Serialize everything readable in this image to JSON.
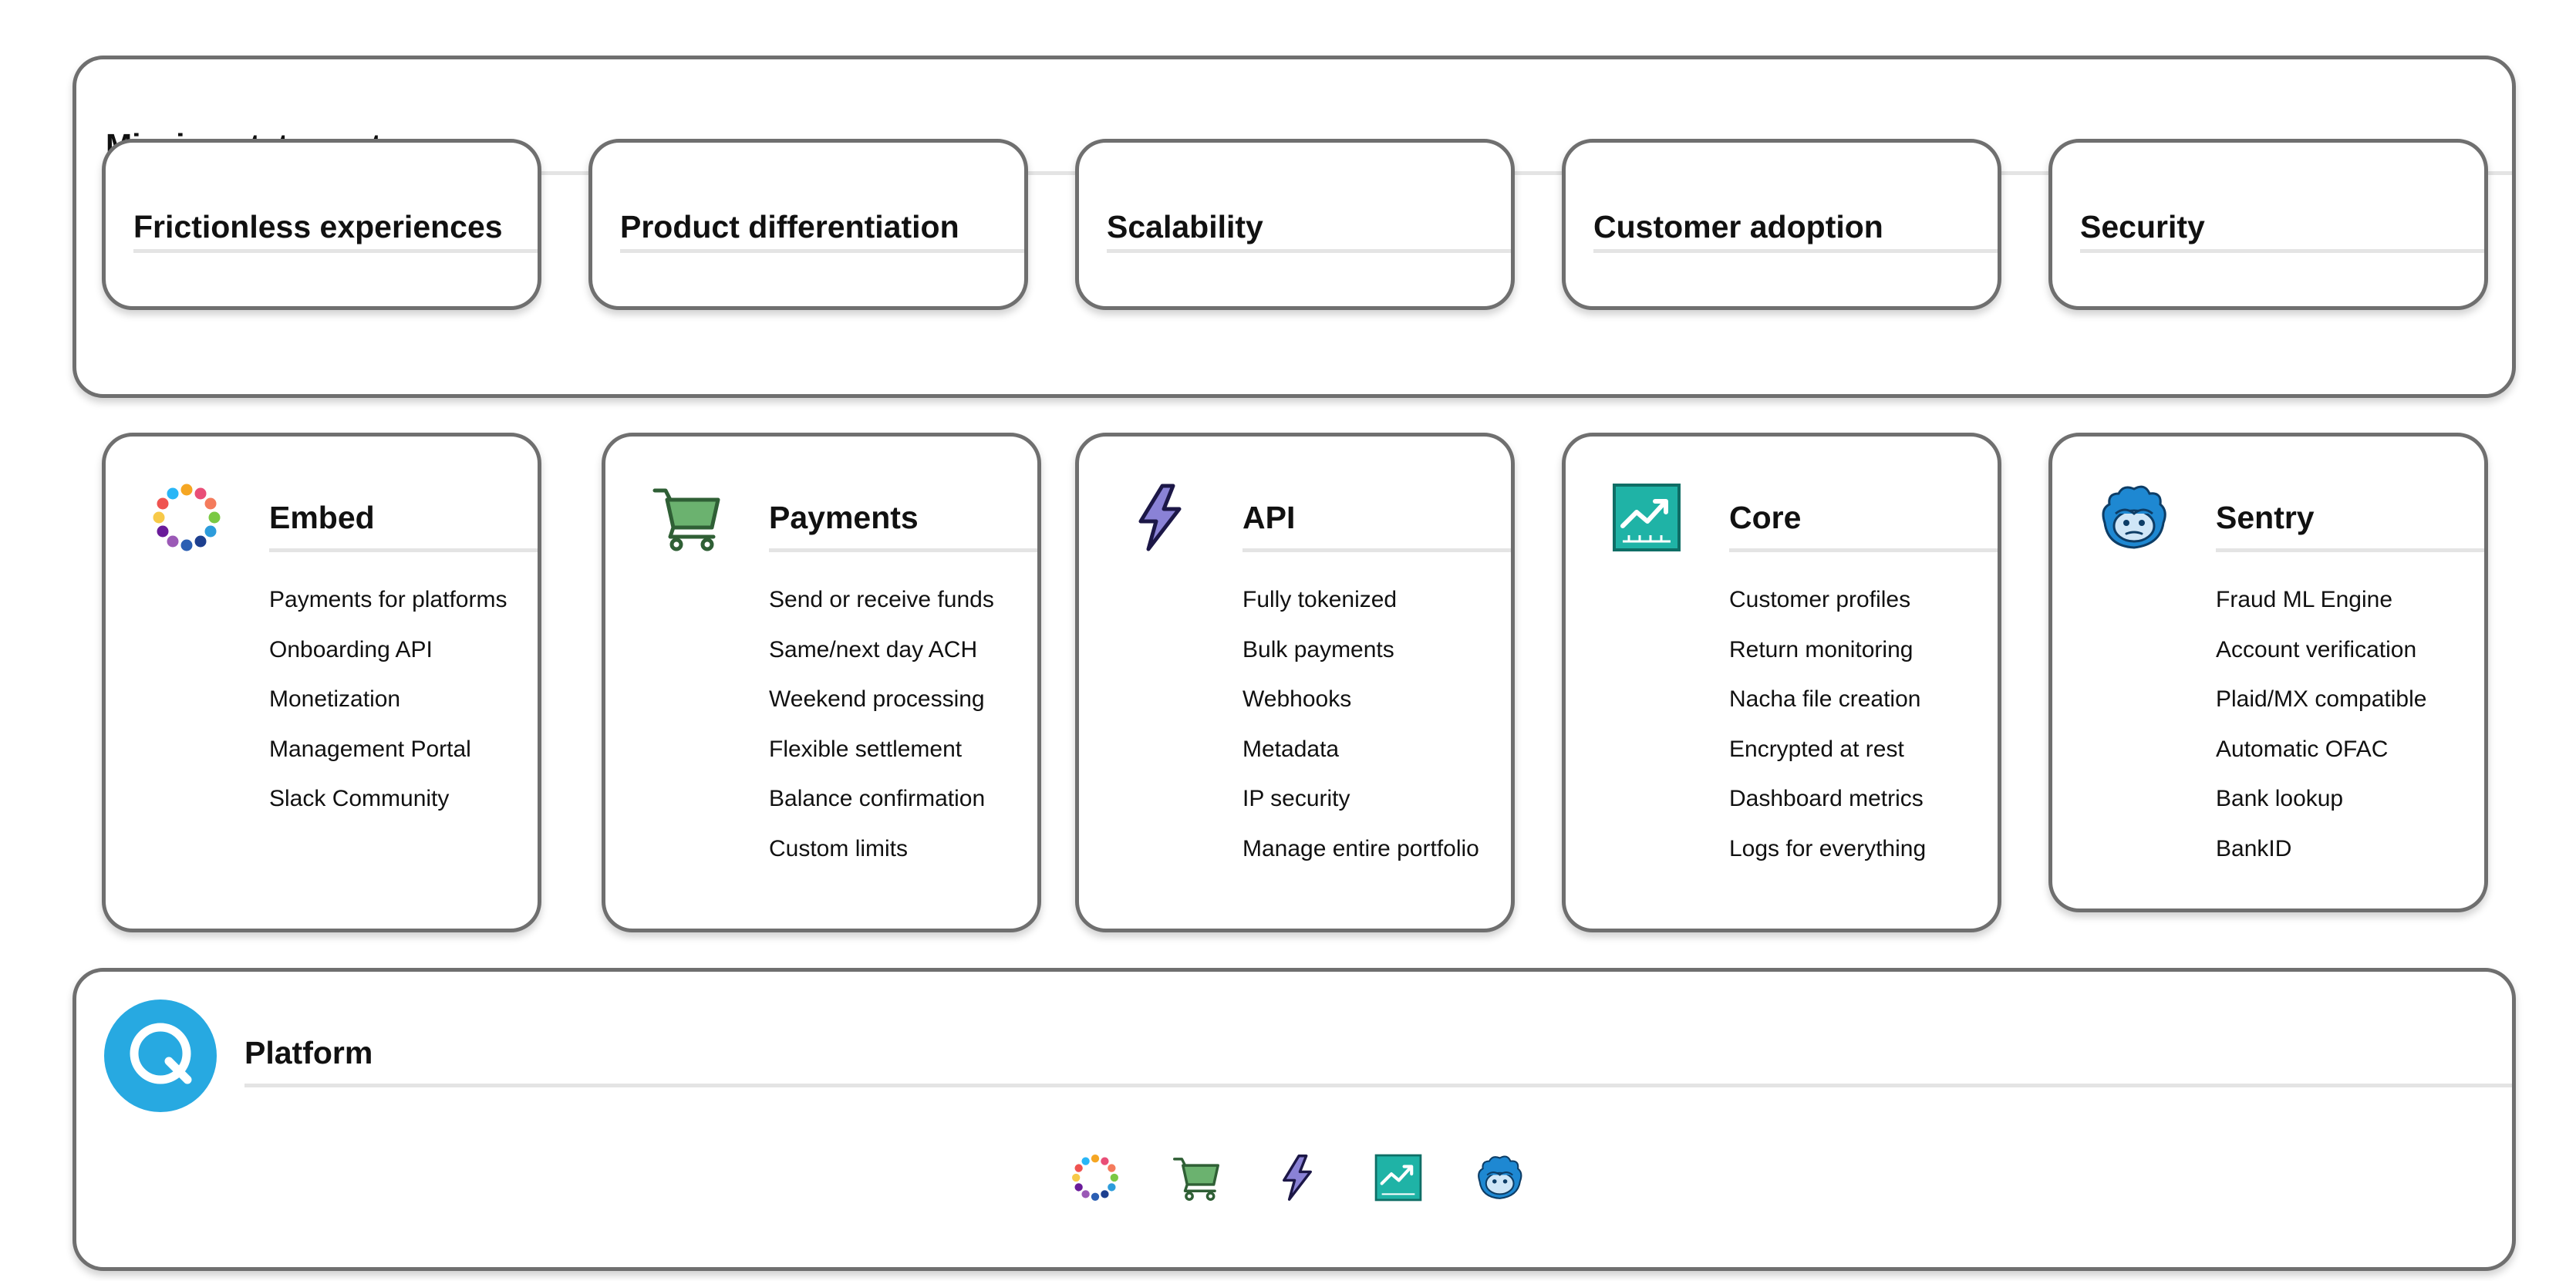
{
  "mission": {
    "title": "Mission statement",
    "goals": [
      "Frictionless experiences",
      "Product differentiation",
      "Scalability",
      "Customer adoption",
      "Security"
    ]
  },
  "products": [
    {
      "name": "Embed",
      "icon": "dots-ring-icon",
      "features": [
        "Payments for platforms",
        "Onboarding API",
        "Monetization",
        "Management Portal",
        "Slack Community"
      ]
    },
    {
      "name": "Payments",
      "icon": "shopping-cart-icon",
      "features": [
        "Send or receive funds",
        "Same/next day ACH",
        "Weekend processing",
        "Flexible settlement",
        "Balance confirmation",
        "Custom limits"
      ]
    },
    {
      "name": "API",
      "icon": "lightning-bolt-icon",
      "features": [
        "Fully tokenized",
        "Bulk payments",
        "Webhooks",
        "Metadata",
        "IP security",
        "Manage entire portfolio"
      ]
    },
    {
      "name": "Core",
      "icon": "trend-chart-icon",
      "features": [
        "Customer profiles",
        "Return monitoring",
        "Nacha file creation",
        "Encrypted at rest",
        "Dashboard metrics",
        "Logs for everything"
      ]
    },
    {
      "name": "Sentry",
      "icon": "mascot-face-icon",
      "features": [
        "Fraud ML Engine",
        "Account verification",
        "Plaid/MX compatible",
        "Automatic OFAC",
        "Bank lookup",
        "BankID"
      ]
    }
  ],
  "platform": {
    "title": "Platform",
    "logo": "q-logo-icon"
  },
  "colors": {
    "border": "#6f6f6f",
    "rule": "#e4e4e4",
    "cart": "#5b9b5f",
    "bolt": "#8a82d6",
    "core": "#1fb3a6",
    "sentry": "#1e88d2",
    "platform": "#27a9e1"
  }
}
